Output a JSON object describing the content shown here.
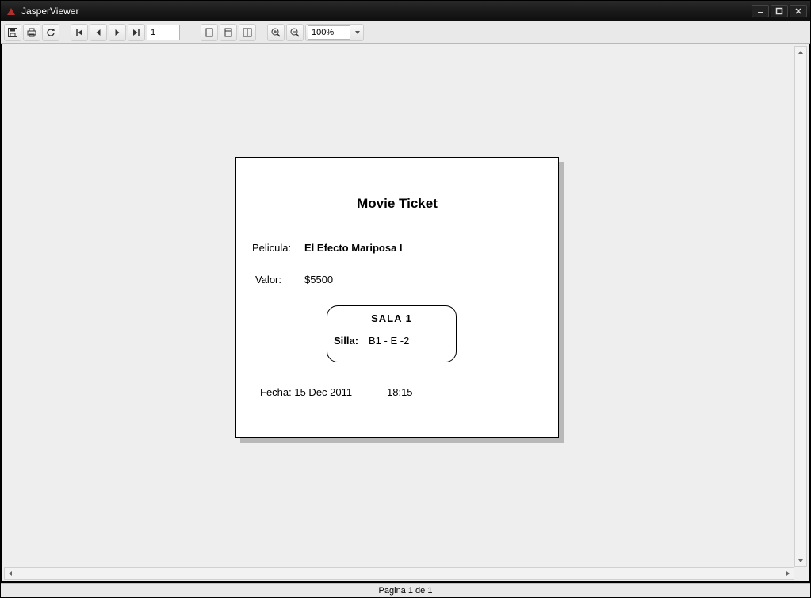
{
  "window": {
    "title": "JasperViewer"
  },
  "toolbar": {
    "page_value": "1",
    "zoom_value": "100%"
  },
  "status": {
    "text": "Pagina 1 de 1"
  },
  "ticket": {
    "title": "Movie Ticket",
    "movie_label": "Pelicula:",
    "movie_value": "El Efecto Mariposa I",
    "price_label": "Valor:",
    "price_value": "$5500",
    "sala_label": "SALA  1",
    "seat_label": "Silla:",
    "seat_value": "B1 - E   -2",
    "date_label": "Fecha: 15 Dec 2011",
    "time_value": "18:15"
  }
}
